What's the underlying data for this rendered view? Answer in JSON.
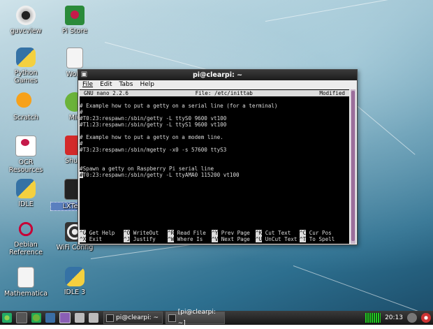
{
  "desktop": {
    "icons": [
      {
        "label": "guvcview"
      },
      {
        "label": "Pi Store"
      },
      {
        "label": "Python\nGames"
      },
      {
        "label": "Wolfr"
      },
      {
        "label": "Scratch"
      },
      {
        "label": "Mid"
      },
      {
        "label": "OCR\nResources"
      },
      {
        "label": "Shutd"
      },
      {
        "label": "IDLE"
      },
      {
        "label": "LXTerm"
      },
      {
        "label": "Debian\nReference"
      },
      {
        "label": "WiFi Config"
      },
      {
        "label": "Mathematica"
      },
      {
        "label": "IDLE 3"
      }
    ]
  },
  "window": {
    "title": "pi@clearpi: ~",
    "menu": [
      "File",
      "Edit",
      "Tabs",
      "Help"
    ]
  },
  "nano": {
    "header_left": "GNU nano 2.2.6",
    "header_center": "File: /etc/inittab",
    "header_right": "Modified",
    "lines": [
      "",
      "# Example how to put a getty on a serial line (for a terminal)",
      "#",
      "#T0:23:respawn:/sbin/getty -L ttyS0 9600 vt100",
      "#T1:23:respawn:/sbin/getty -L ttyS1 9600 vt100",
      "",
      "# Example how to put a getty on a modem line.",
      "#",
      "#T3:23:respawn:/sbin/mgetty -x0 -s 57600 ttyS3",
      "",
      "",
      "#Spawn a getty on Raspberry Pi serial line",
      "T0:23:respawn:/sbin/getty -L ttyAMA0 115200 vt100"
    ],
    "cursor_char": "#",
    "shortcuts_row1": [
      {
        "key": "^G",
        "label": "Get Help"
      },
      {
        "key": "^O",
        "label": "WriteOut"
      },
      {
        "key": "^R",
        "label": "Read File"
      },
      {
        "key": "^Y",
        "label": "Prev Page"
      },
      {
        "key": "^K",
        "label": "Cut Text"
      },
      {
        "key": "^C",
        "label": "Cur Pos"
      }
    ],
    "shortcuts_row2": [
      {
        "key": "^X",
        "label": "Exit"
      },
      {
        "key": "^J",
        "label": "Justify"
      },
      {
        "key": "^W",
        "label": "Where Is"
      },
      {
        "key": "^V",
        "label": "Next Page"
      },
      {
        "key": "^U",
        "label": "UnCut Text"
      },
      {
        "key": "^T",
        "label": "To Spell"
      }
    ]
  },
  "taskbar": {
    "tasks": [
      "pi@clearpi: ~",
      "[pi@clearpi: ~]"
    ],
    "clock": "20:13"
  },
  "colors": {
    "terminal_bg": "#000000",
    "title_bg": "#1c1c1c",
    "scrollbar": "#9b6e9b"
  }
}
